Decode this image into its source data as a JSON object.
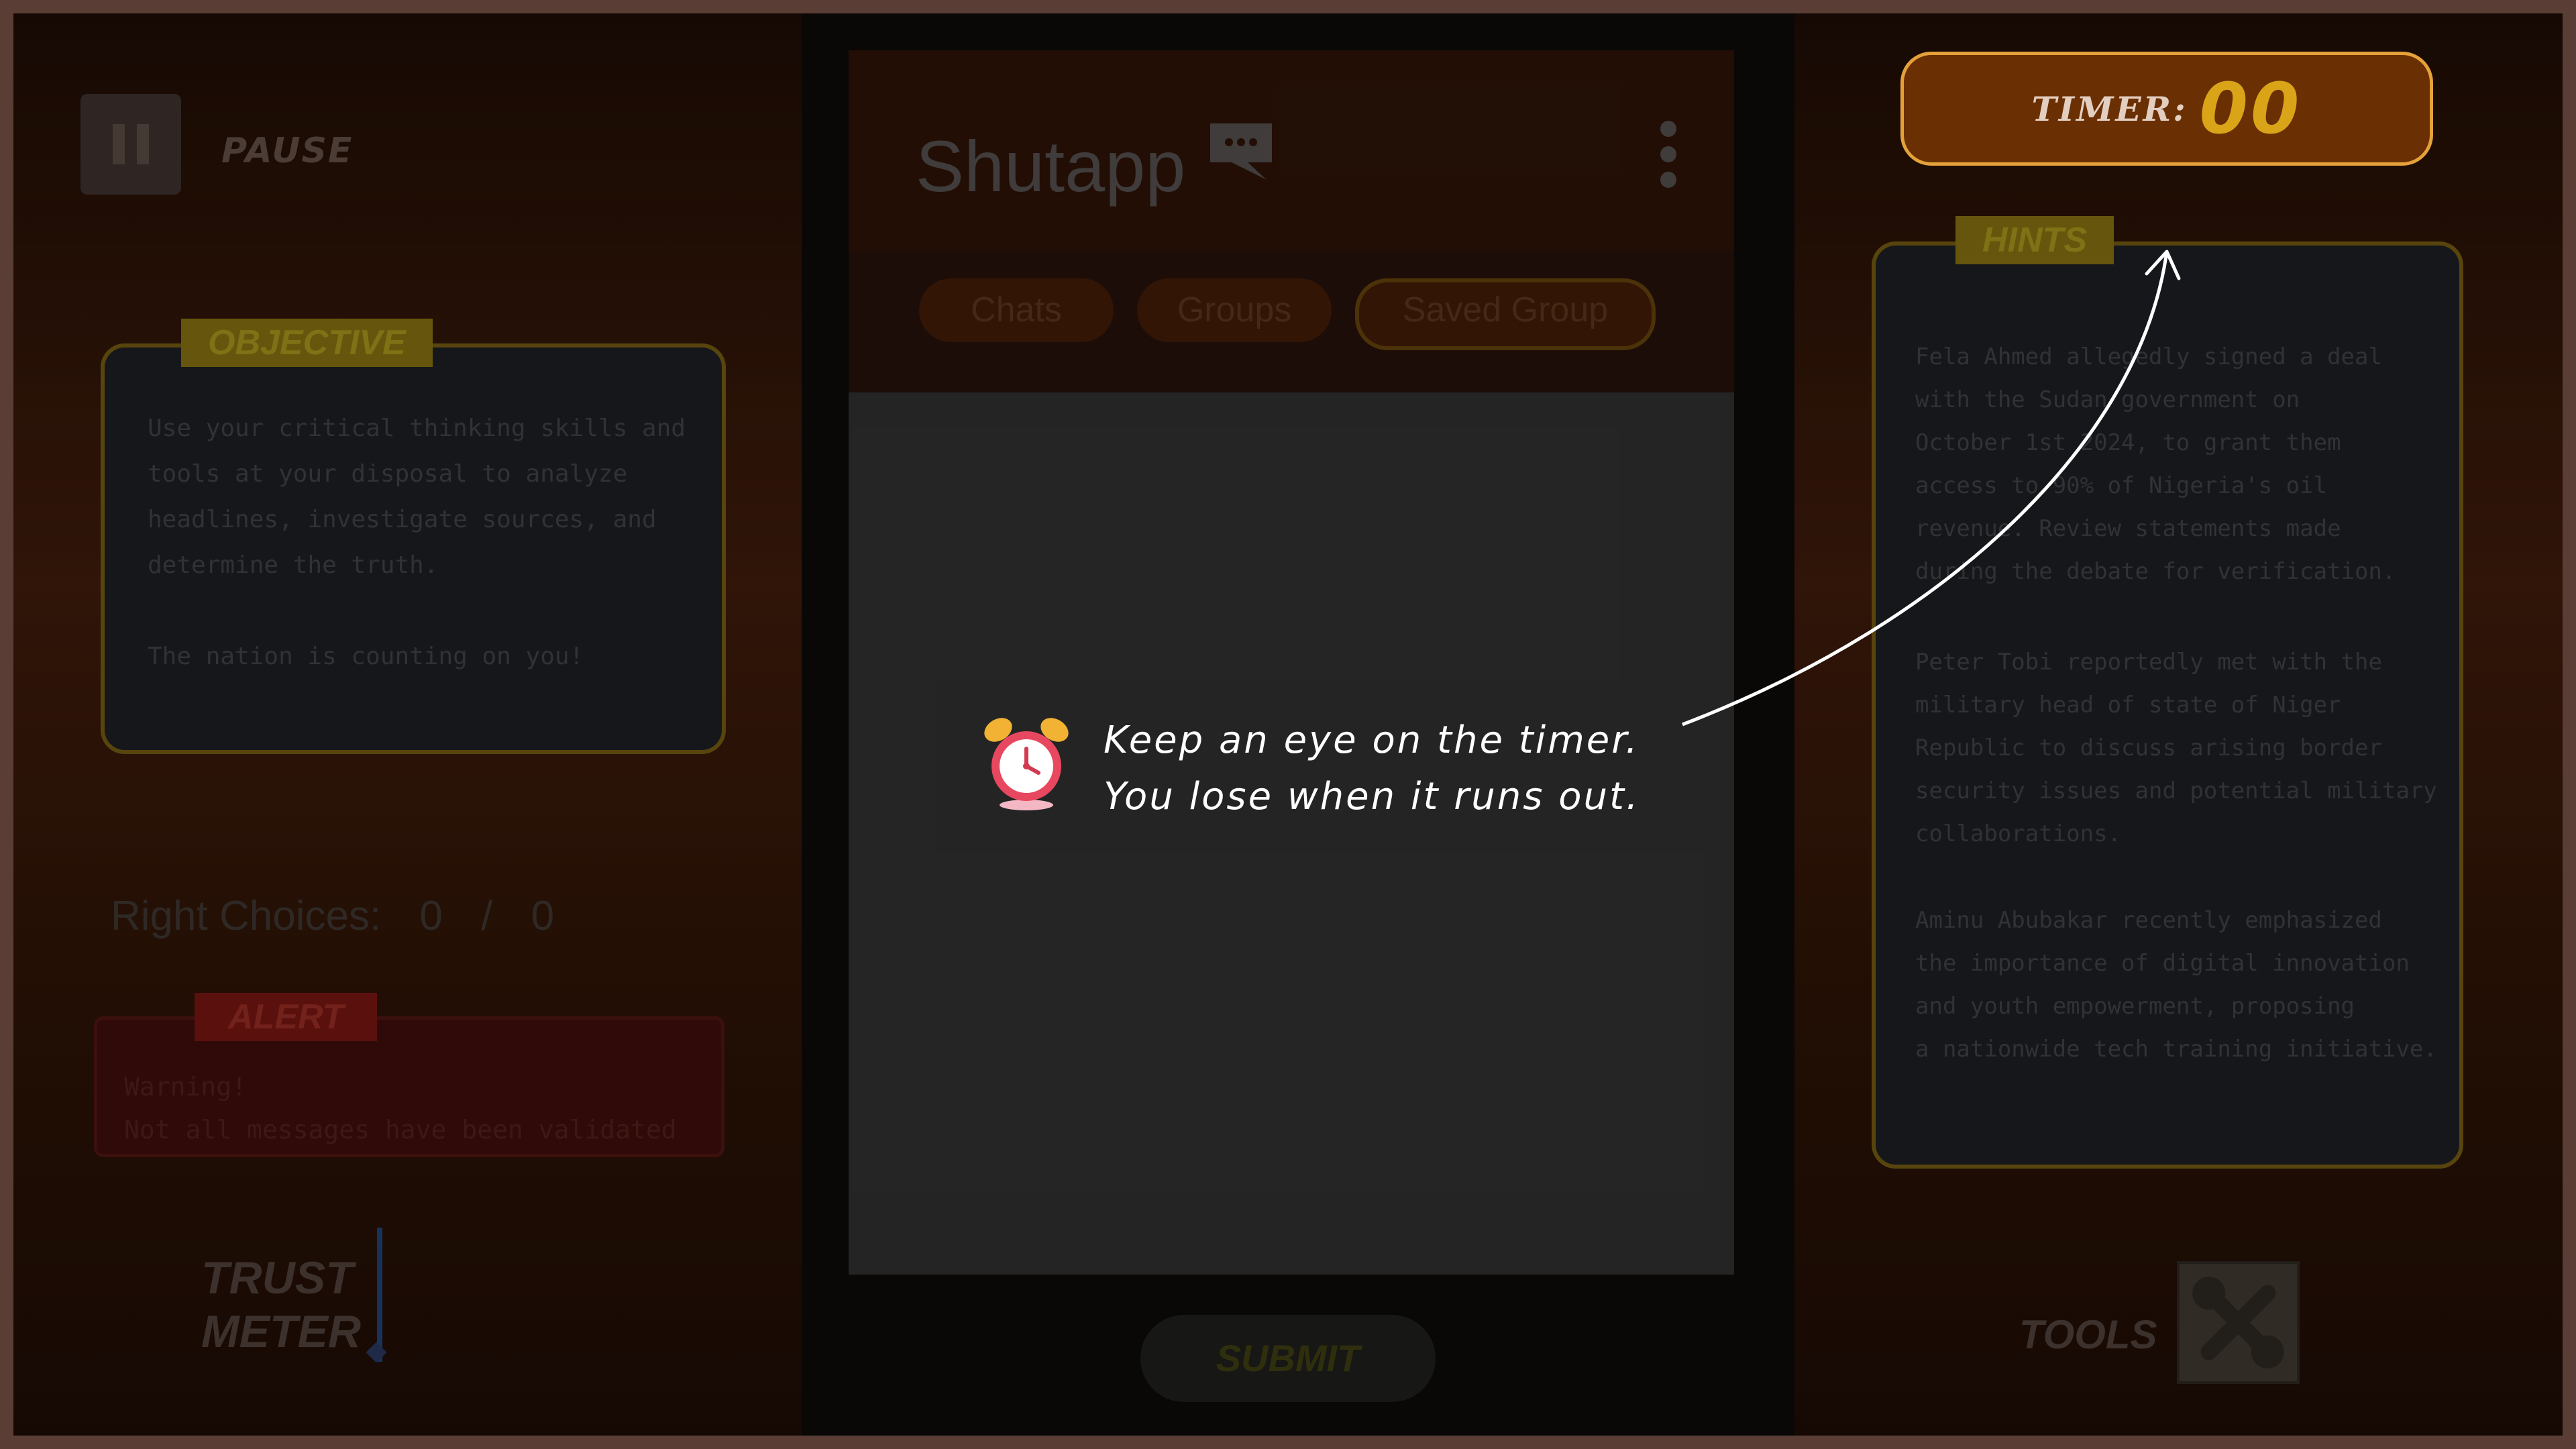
{
  "pause": {
    "label": "PAUSE"
  },
  "objective": {
    "tag": "OBJECTIVE",
    "text": "Use your critical thinking skills and\ntools at your disposal to analyze\nheadlines, investigate sources, and\ndetermine the truth.\n\nThe nation is counting on you!"
  },
  "score": {
    "label": "Right Choices:",
    "correct": "0",
    "separator": "/",
    "total": "0"
  },
  "alert": {
    "tag": "ALERT",
    "line1": "Warning!",
    "line2": "Not all messages have been validated"
  },
  "trust_meter": {
    "line1": "TRUST",
    "line2": "METER"
  },
  "app": {
    "title": "Shutapp",
    "tabs": [
      "Chats",
      "Groups",
      "Saved Group"
    ],
    "submit_label": "SUBMIT"
  },
  "hints": {
    "tag": "HINTS",
    "paragraphs": [
      "Fela Ahmed allegedly signed a deal\nwith the Sudan government on\nOctober 1st 2024, to grant them\naccess to 90% of Nigeria's oil\nrevenue. Review statements made\nduring the debate for verification.",
      "Peter Tobi reportedly met with the\nmilitary head of state of Niger\nRepublic to discuss arising border\nsecurity issues and potential military\ncollaborations.",
      "Aminu Abubakar recently emphasized\nthe importance of digital innovation\nand youth empowerment, proposing\na nationwide tech training initiative."
    ]
  },
  "tools": {
    "label": "TOOLS"
  },
  "timer": {
    "label": "TIMER:",
    "value": "00"
  },
  "tutorial": {
    "line1": "Keep an eye on the timer.",
    "line2": "You lose when it runs out.",
    "icon": "alarm-clock-icon"
  },
  "colors": {
    "accent": "#e5a23a",
    "timer_bg": "#6b2f04",
    "timer_value": "#d9a417"
  }
}
